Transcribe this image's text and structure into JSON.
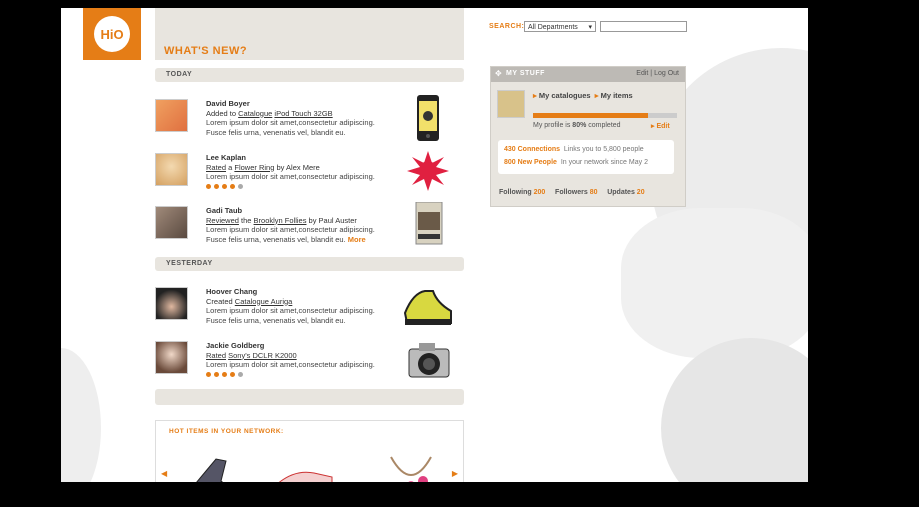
{
  "logo": "HiO",
  "header": {
    "title": "WHAT'S NEW?"
  },
  "search": {
    "label": "SEARCH:",
    "department": "All Departments"
  },
  "sections": {
    "today": "TODAY",
    "yesterday": "YESTERDAY"
  },
  "feed": [
    {
      "name": "David Boyer",
      "action_prefix": "Added to",
      "link1": "Catalogue",
      "mid": "",
      "link2": "iPod Touch 32GB",
      "suffix": "",
      "line1": "Lorem ipsum dolor sit amet,consectetur adipiscing.",
      "line2": "Fusce felis urna, venenatis vel, blandit eu.",
      "more": ""
    },
    {
      "name": "Lee Kaplan",
      "action_prefix": "",
      "link1": "Rated",
      "mid": " a ",
      "link2": "Flower Ring",
      "suffix": " by Alex Mere",
      "line1": "Lorem ipsum dolor sit amet,consectetur adipiscing.",
      "line2": "",
      "more": "",
      "rating": 4
    },
    {
      "name": "Gadi Taub",
      "action_prefix": "",
      "link1": "Reviewed",
      "mid": " the ",
      "link2": "Brooklyn Follies",
      "suffix": " by Paul Auster",
      "line1": "Lorem ipsum dolor sit amet,consectetur adipiscing.",
      "line2": "Fusce felis urna, venenatis vel, blandit eu.",
      "more": "More"
    },
    {
      "name": "Hoover Chang",
      "action_prefix": "Created",
      "link1": "Catalogue Auriga",
      "mid": "",
      "link2": "",
      "suffix": "",
      "line1": "Lorem ipsum dolor sit amet,consectetur adipiscing.",
      "line2": "Fusce felis urna, venenatis vel, blandit eu.",
      "more": ""
    },
    {
      "name": "Jackie Goldberg",
      "action_prefix": "",
      "link1": "Rated",
      "mid": " ",
      "link2": "Sony's DCLR K2000",
      "suffix": "",
      "line1": "Lorem ipsum dolor sit amet,consectetur adipiscing.",
      "line2": "",
      "more": "",
      "rating": 4
    }
  ],
  "hot": {
    "title": "HOT ITEMS IN YOUR NETWORK:"
  },
  "mystuff": {
    "title": "MY STUFF",
    "edit": "Edit",
    "logout": "Log Out",
    "catalogues": "My catalogues",
    "items": "My items",
    "profile_pre": "My profile is ",
    "profile_pct": "80%",
    "profile_post": " completed",
    "profile_fraction": 0.8,
    "edit_link": "Edit",
    "connections_count": "430 Connections",
    "connections_text": "Links you to 5,800 people",
    "new_people_count": "800 New People",
    "new_people_text": "In your network since May 2",
    "following_label": "Following",
    "following": "200",
    "followers_label": "Followers",
    "followers": "80",
    "updates_label": "Updates",
    "updates": "20"
  },
  "colors": {
    "accent": "#e57d16",
    "panel": "#e8e5df"
  }
}
